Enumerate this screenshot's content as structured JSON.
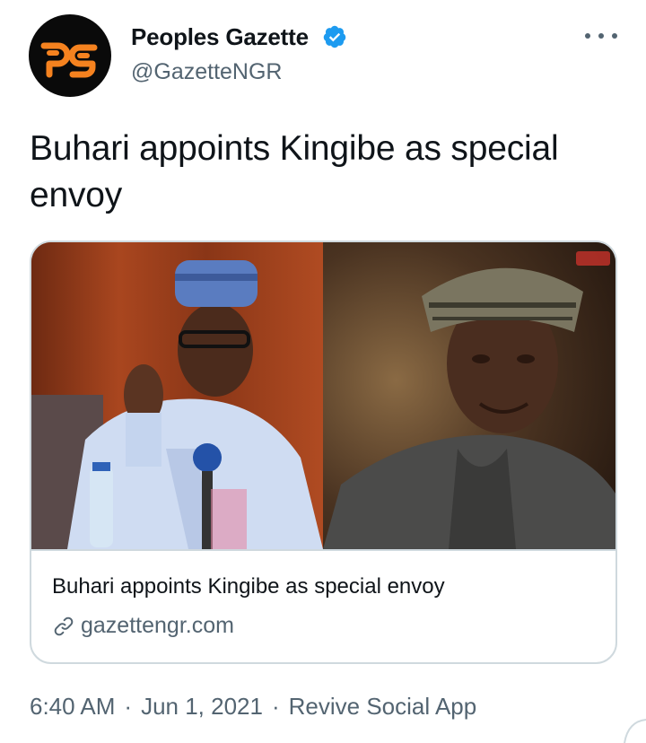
{
  "account": {
    "display_name": "Peoples Gazette",
    "handle": "@GazetteNGR",
    "avatar_logo": "pg",
    "verified": true,
    "verified_color": "#1d9bf0",
    "logo_color": "#f5821f"
  },
  "tweet": {
    "text": "Buhari appoints Kingibe as special envoy"
  },
  "card": {
    "title": "Buhari appoints Kingibe as special envoy",
    "domain": "gazettengr.com",
    "link_icon": "link-icon"
  },
  "meta": {
    "time": "6:40 AM",
    "separator": "·",
    "date": "Jun 1, 2021",
    "source": "Revive Social App"
  },
  "icons": {
    "more": "more-options-icon",
    "verified": "verified-badge-icon"
  }
}
